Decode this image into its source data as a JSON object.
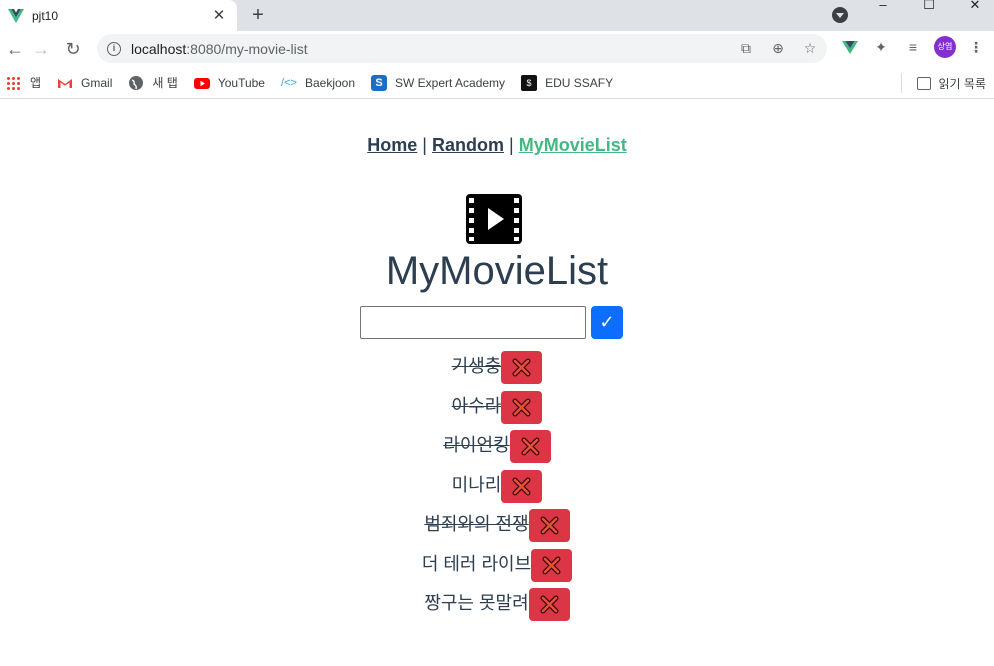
{
  "browser": {
    "tab_title": "pjt10",
    "url_host": "localhost",
    "url_rest": ":8080/my-movie-list",
    "avatar_text": "상엽",
    "bookmarks": [
      {
        "label": "앱",
        "icon": "apps-icon"
      },
      {
        "label": "Gmail",
        "icon": "gmail-icon"
      },
      {
        "label": "새 탭",
        "icon": "globe-icon"
      },
      {
        "label": "YouTube",
        "icon": "youtube-icon"
      },
      {
        "label": "Baekjoon",
        "icon": "code-icon"
      },
      {
        "label": "SW Expert Academy",
        "icon": "swea-icon"
      },
      {
        "label": "EDU SSAFY",
        "icon": "ssafy-icon"
      }
    ],
    "reading_list": "읽기 목록"
  },
  "nav": {
    "home": "Home",
    "random": "Random",
    "mylist": "MyMovieList",
    "separator": "|",
    "active_color": "#42b983"
  },
  "page": {
    "title": "MyMovieList",
    "input_value": "",
    "add_button_label": "✓"
  },
  "movies": [
    {
      "title": "기생충",
      "watched": true
    },
    {
      "title": "아수라",
      "watched": true
    },
    {
      "title": "라이언킹",
      "watched": true
    },
    {
      "title": "미나리",
      "watched": false
    },
    {
      "title": "범죄와의 전쟁",
      "watched": true
    },
    {
      "title": "더 테러 라이브",
      "watched": false
    },
    {
      "title": "짱구는 못말려",
      "watched": false
    }
  ],
  "colors": {
    "text": "#2c3e50",
    "primary": "#0d6efd",
    "danger": "#dc3545"
  }
}
